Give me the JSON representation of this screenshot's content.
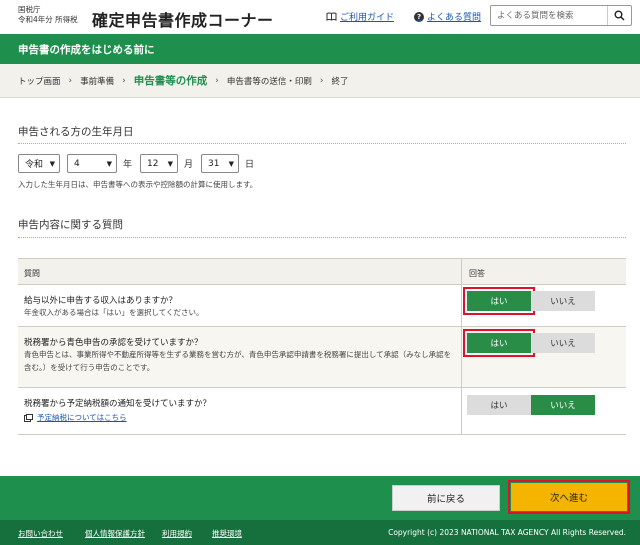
{
  "header": {
    "agency": "国税庁",
    "agency_year": "令和4年分",
    "agency_tax": "所得税",
    "title": "確定申告書作成コーナー",
    "guide_link": "ご利用ガイド",
    "faq_link": "よくある質問",
    "search_placeholder": "よくある質問を検索"
  },
  "banner": "申告書の作成をはじめる前に",
  "breadcrumb": [
    "トップ画面",
    "事前準備",
    "申告書等の作成",
    "申告書等の送信・印刷",
    "終了"
  ],
  "birth": {
    "title": "申告される方の生年月日",
    "era": "令和",
    "year": "4",
    "year_unit": "年",
    "month": "12",
    "month_unit": "月",
    "day": "31",
    "day_unit": "日",
    "note": "入力した生年月日は、申告書等への表示や控除額の計算に使用します。"
  },
  "questions": {
    "title": "申告内容に関する質問",
    "col_question": "質問",
    "col_answer": "回答",
    "yes": "はい",
    "no": "いいえ",
    "q1": {
      "text": "給与以外に申告する収入はありますか？",
      "sub": "年金収入がある場合は「はい」を選択してください。",
      "answer": "yes"
    },
    "q2": {
      "text": "税務署から青色申告の承認を受けていますか？",
      "sub": "青色申告とは、事業所得や不動産所得等を生ずる業務を営む方が、青色申告承認申請書を税務署に提出して承認（みなし承認を含む。）を受けて行う申告のことです。",
      "answer": "yes"
    },
    "q3": {
      "text": "税務署から予定納税額の通知を受けていますか？",
      "link": "予定納税についてはこちら",
      "answer": "no"
    }
  },
  "nav": {
    "back": "前に戻る",
    "next": "次へ進む"
  },
  "footer": {
    "links": [
      "お問い合わせ",
      "個人情報保護方針",
      "利用規約",
      "推奨環境"
    ],
    "copyright": "Copyright (c) 2023 NATIONAL TAX AGENCY All Rights Reserved."
  }
}
